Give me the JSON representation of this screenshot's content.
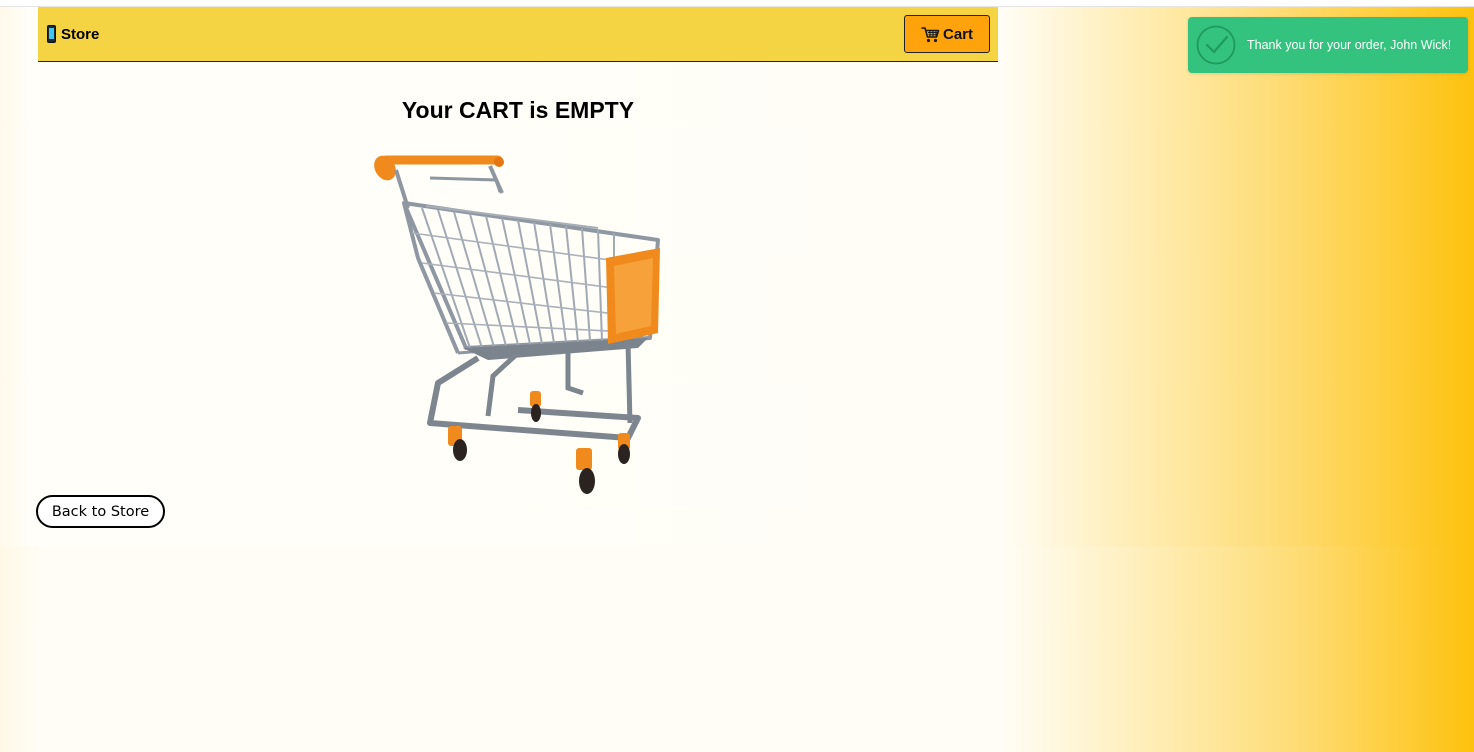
{
  "navbar": {
    "brand_icon": "mobile-phone-icon",
    "brand_label": "Store",
    "cart_icon": "shopping-cart-icon",
    "cart_label": "Cart"
  },
  "main": {
    "empty_title": "Your CART is EMPTY",
    "illustration": "shopping-cart-illustration",
    "back_button_label": "Back to Store"
  },
  "toast": {
    "icon": "check-circle-icon",
    "message": "Thank you for your order, John Wick!"
  },
  "colors": {
    "navbar_bg": "#f5d443",
    "cart_button_bg": "#ffa30d",
    "toast_bg": "#34c37e",
    "gradient_end": "#fdc20e"
  }
}
